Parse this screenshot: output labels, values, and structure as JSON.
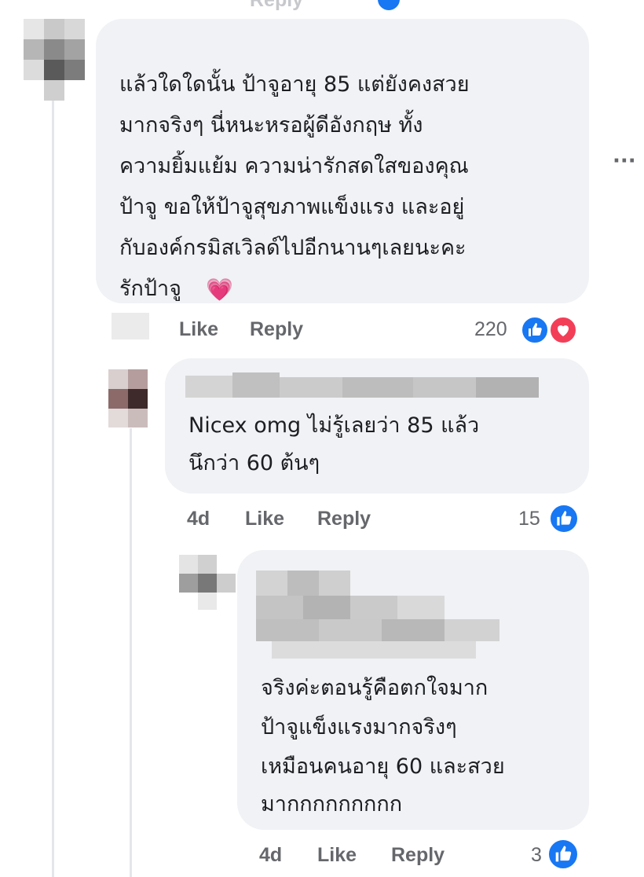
{
  "top_partial": {
    "reply_label": "Reply"
  },
  "comment1": {
    "author": "",
    "lines": [
      "แล้วใดใดนั้น ป้าจูอายุ 85 แต่ยังคงสวย",
      "มากจริงๆ นี่หนะหรอผู้ดีอังกฤษ ทั้ง",
      "ความยิ้มแย้ม ความน่ารักสดใสของคุณ",
      "ป้าจู ขอให้ป้าจูสุขภาพแข็งแรง และอยู่",
      "กับองค์กรมิสเวิลด์ไปอีกนานๆเลยนะคะ",
      "รักป้าจู"
    ],
    "emoji": "💗",
    "like_label": "Like",
    "reply_label": "Reply",
    "reaction_count": "220",
    "more_label": "···"
  },
  "reply1": {
    "lines": [
      "Nicex omg ไม่รู้เลยว่า 85 แล้ว",
      "นึกว่า 60 ต้นๆ"
    ],
    "time": "4d",
    "like_label": "Like",
    "reply_label": "Reply",
    "reaction_count": "15"
  },
  "reply2": {
    "lines": [
      "จริงค่ะตอนรู้คือตกใจมาก",
      "ป้าจูแข็งแรงมากจริงๆ",
      "เหมือนคนอายุ 60 และสวย",
      "มากกกกกกกกก"
    ],
    "time": "4d",
    "like_label": "Like",
    "reply_label": "Reply",
    "reaction_count": "3"
  },
  "colors": {
    "like_blue": "#1877f2",
    "love_red": "#f33e58",
    "bubble": "#f0f2f5",
    "meta": "#65676b"
  }
}
